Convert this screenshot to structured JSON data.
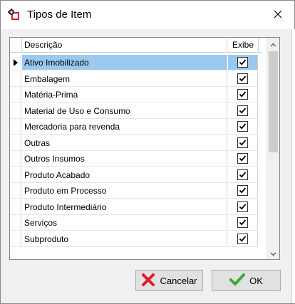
{
  "window": {
    "title": "Tipos de Item",
    "app_icon": "app-settings-icon",
    "close_icon": "close-icon"
  },
  "grid": {
    "columns": {
      "descricao": "Descrição",
      "exibe": "Exibe"
    },
    "rows": [
      {
        "descricao": "Ativo Imobilizado",
        "exibe": true,
        "selected": true
      },
      {
        "descricao": "Embalagem",
        "exibe": true
      },
      {
        "descricao": "Matéria-Prima",
        "exibe": true
      },
      {
        "descricao": "Material de Uso e Consumo",
        "exibe": true
      },
      {
        "descricao": "Mercadoria para revenda",
        "exibe": true
      },
      {
        "descricao": "Outras",
        "exibe": true
      },
      {
        "descricao": "Outros Insumos",
        "exibe": true
      },
      {
        "descricao": "Produto Acabado",
        "exibe": true
      },
      {
        "descricao": "Produto em Processo",
        "exibe": true
      },
      {
        "descricao": "Produto Intermediário",
        "exibe": true
      },
      {
        "descricao": "Serviços",
        "exibe": true
      },
      {
        "descricao": "Subproduto",
        "exibe": true
      }
    ]
  },
  "buttons": {
    "cancel_label": "Cancelar",
    "cancel_icon": "x-icon",
    "ok_label": "OK",
    "ok_icon": "check-icon"
  },
  "colors": {
    "selected_row": "#99c9ef",
    "cancel_icon": "#d81e2a",
    "ok_icon": "#3aa935"
  }
}
